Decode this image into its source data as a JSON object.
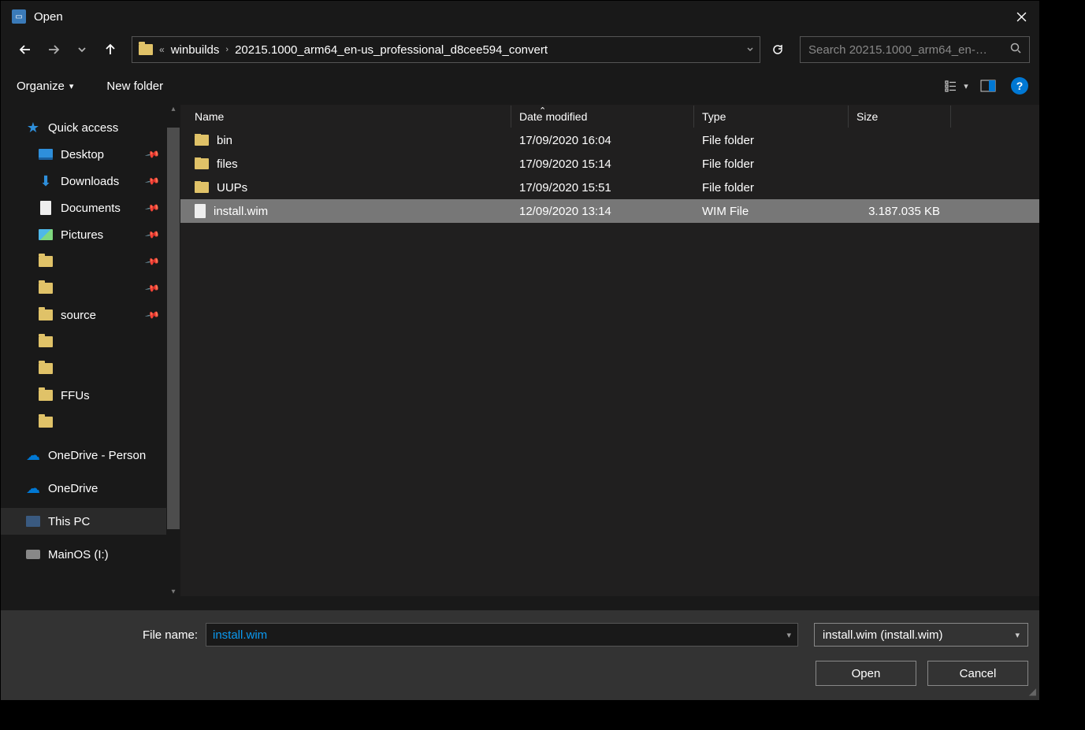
{
  "window": {
    "title": "Open"
  },
  "nav": {
    "crumb_prefix": "«",
    "crumbs": [
      "winbuilds",
      "20215.1000_arm64_en-us_professional_d8cee594_convert"
    ],
    "search_placeholder": "Search 20215.1000_arm64_en-…"
  },
  "toolbar": {
    "organize": "Organize",
    "new_folder": "New folder",
    "help": "?"
  },
  "sidebar": {
    "quick_access": "Quick access",
    "items": [
      {
        "label": "Desktop",
        "icon": "desktop",
        "pinned": true
      },
      {
        "label": "Downloads",
        "icon": "download",
        "pinned": true
      },
      {
        "label": "Documents",
        "icon": "document",
        "pinned": true
      },
      {
        "label": "Pictures",
        "icon": "picture",
        "pinned": true
      },
      {
        "label": "",
        "icon": "folder",
        "pinned": true
      },
      {
        "label": "",
        "icon": "folder",
        "pinned": true
      },
      {
        "label": "source",
        "icon": "folder",
        "pinned": true
      },
      {
        "label": "",
        "icon": "folder",
        "pinned": false
      },
      {
        "label": "",
        "icon": "folder",
        "pinned": false
      },
      {
        "label": "FFUs",
        "icon": "folder",
        "pinned": false
      },
      {
        "label": "",
        "icon": "folder",
        "pinned": false
      }
    ],
    "onedrive_personal": "OneDrive - Person",
    "onedrive": "OneDrive",
    "this_pc": "This PC",
    "mainos": "MainOS (I:)"
  },
  "columns": {
    "name": "Name",
    "date": "Date modified",
    "type": "Type",
    "size": "Size"
  },
  "files": [
    {
      "name": "bin",
      "date": "17/09/2020 16:04",
      "type": "File folder",
      "size": "",
      "icon": "folder",
      "selected": false
    },
    {
      "name": "files",
      "date": "17/09/2020 15:14",
      "type": "File folder",
      "size": "",
      "icon": "folder",
      "selected": false
    },
    {
      "name": "UUPs",
      "date": "17/09/2020 15:51",
      "type": "File folder",
      "size": "",
      "icon": "folder",
      "selected": false
    },
    {
      "name": "install.wim",
      "date": "12/09/2020 13:14",
      "type": "WIM File",
      "size": "3.187.035 KB",
      "icon": "file",
      "selected": true
    }
  ],
  "footer": {
    "filename_label": "File name:",
    "filename_value": "install.wim",
    "filter": "install.wim (install.wim)",
    "open": "Open",
    "cancel": "Cancel"
  }
}
